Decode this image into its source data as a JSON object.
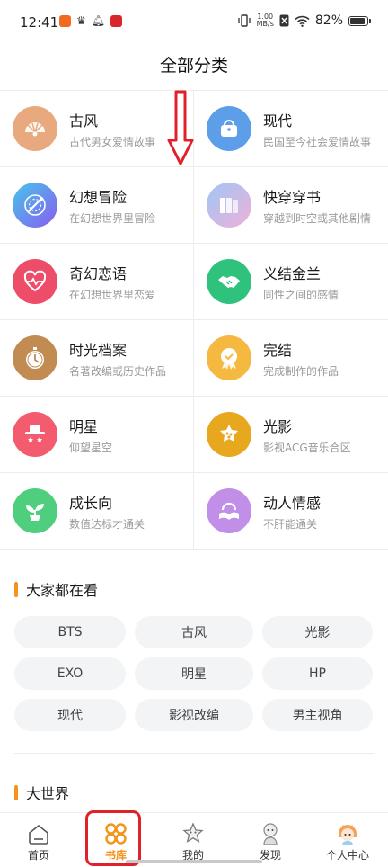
{
  "status_bar": {
    "time": "12:41",
    "speed_value": "1.00",
    "speed_unit": "MB/s",
    "battery": "82%"
  },
  "header": {
    "title": "全部分类"
  },
  "categories": [
    {
      "title": "古风",
      "desc": "古代男女爱情故事",
      "icon": "fan-icon",
      "color": "#e9a97e"
    },
    {
      "title": "现代",
      "desc": "民国至今社会爱情故事",
      "icon": "handbag-icon",
      "color": "#5d9ee8"
    },
    {
      "title": "幻想冒险",
      "desc": "在幻想世界里冒险",
      "icon": "magic-circle-icon",
      "color": "#7b6ef0"
    },
    {
      "title": "快穿穿书",
      "desc": "穿越到时空或其他剧情",
      "icon": "books-icon",
      "color": "#c9a4f0"
    },
    {
      "title": "奇幻恋语",
      "desc": "在幻想世界里恋爱",
      "icon": "heartbeat-icon",
      "color": "#ee4d6a"
    },
    {
      "title": "义结金兰",
      "desc": "同性之间的感情",
      "icon": "handshake-icon",
      "color": "#2fc27d"
    },
    {
      "title": "时光档案",
      "desc": "名著改编或历史作品",
      "icon": "pocket-watch-icon",
      "color": "#c28b52"
    },
    {
      "title": "完结",
      "desc": "完成制作的作品",
      "icon": "medal-icon",
      "color": "#f5b841"
    },
    {
      "title": "明星",
      "desc": "仰望星空",
      "icon": "star-hat-icon",
      "color": "#f35b6e"
    },
    {
      "title": "光影",
      "desc": "影视ACG音乐合区",
      "icon": "film-palette-icon",
      "color": "#e7a820"
    },
    {
      "title": "成长向",
      "desc": "数值达标才通关",
      "icon": "sprout-icon",
      "color": "#4fcf7e"
    },
    {
      "title": "动人情感",
      "desc": "不肝能通关",
      "icon": "open-book-icon",
      "color": "#c18ee8"
    }
  ],
  "popular": {
    "title": "大家都在看",
    "tags": [
      "BTS",
      "古风",
      "光影",
      "EXO",
      "明星",
      "HP",
      "现代",
      "影视改编",
      "男主视角"
    ]
  },
  "world": {
    "title": "大世界"
  },
  "bottom_nav": {
    "items": [
      {
        "label": "首页",
        "icon": "home-icon"
      },
      {
        "label": "书库",
        "icon": "library-icon"
      },
      {
        "label": "我的",
        "icon": "star-sticker-icon"
      },
      {
        "label": "发现",
        "icon": "character-icon"
      },
      {
        "label": "个人中心",
        "icon": "avatar-icon"
      }
    ],
    "active_index": 1,
    "accent": "#f39318"
  }
}
